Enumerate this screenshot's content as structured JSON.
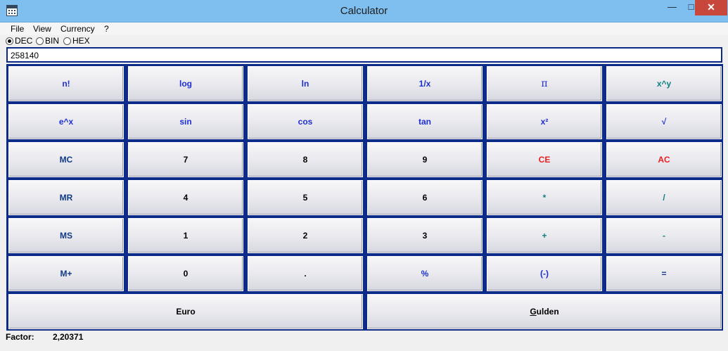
{
  "window": {
    "title": "Calculator",
    "close_glyph": "✕",
    "min_glyph": "—",
    "max_glyph": "□"
  },
  "menu": [
    "File",
    "View",
    "Currency",
    "?"
  ],
  "number_base": {
    "options": [
      "DEC",
      "BIN",
      "HEX"
    ],
    "selected": "DEC"
  },
  "display": {
    "value": "258140"
  },
  "keys": [
    [
      "n!",
      "log",
      "ln",
      "1/x",
      "π",
      "x^y"
    ],
    [
      "e^x",
      "sin",
      "cos",
      "tan",
      "x²",
      "√"
    ],
    [
      "MC",
      "7",
      "8",
      "9",
      "CE",
      "AC"
    ],
    [
      "MR",
      "4",
      "5",
      "6",
      "*",
      "/"
    ],
    [
      "MS",
      "1",
      "2",
      "3",
      "+",
      "-"
    ],
    [
      "M+",
      "0",
      ".",
      "%",
      "(-)",
      "="
    ]
  ],
  "currency_keys": {
    "left": "Euro",
    "right_underlined": "G",
    "right_rest": "ulden"
  },
  "status": {
    "label": "Factor:",
    "value": "2,20371"
  }
}
